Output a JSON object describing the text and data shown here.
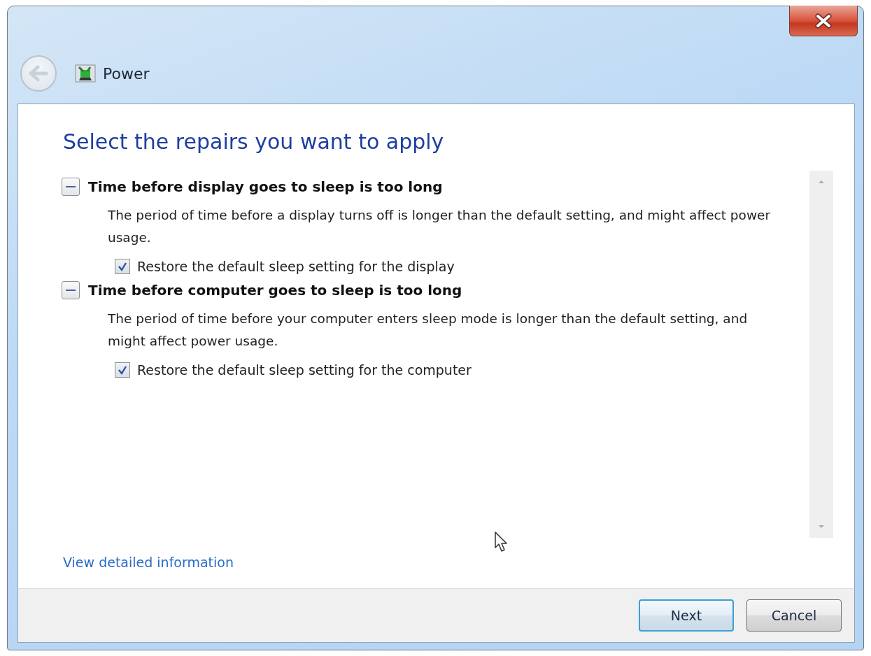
{
  "window": {
    "title": "Power"
  },
  "heading": "Select the repairs you want to apply",
  "repairs": [
    {
      "title": "Time before display goes to sleep is too long",
      "expanded": true,
      "description": "The period of time before a display turns off is longer than the default setting, and might affect power usage.",
      "option": {
        "label": "Restore the default sleep setting for the display",
        "checked": true
      }
    },
    {
      "title": "Time before computer goes to sleep is too long",
      "expanded": true,
      "description": "The period of time before your computer enters sleep mode is longer than the default setting, and might affect power usage.",
      "option": {
        "label": "Restore the default sleep setting for the computer",
        "checked": true
      }
    }
  ],
  "link": "View detailed information",
  "buttons": [
    {
      "label": "Next",
      "default": true
    },
    {
      "label": "Cancel",
      "default": false
    }
  ]
}
